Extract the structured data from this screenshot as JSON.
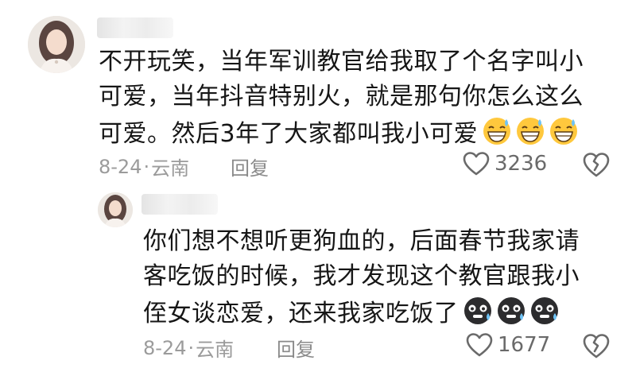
{
  "comments": [
    {
      "text": "不开玩笑，当年军训教官给我取了个名字叫小可爱，当年抖音特别火，就是那句你怎么这么可爱。然后3年了大家都叫我小可爱",
      "line1": "不开玩笑，当年军训教官给我取了个名字叫小",
      "line2": "可爱，当年抖音特别火，就是那句你怎么这么",
      "line3": "可爱。然后3年了大家都叫我小可爱",
      "emojis": [
        "grin-sweat-emoji",
        "grin-sweat-emoji",
        "grin-sweat-emoji"
      ],
      "date": "8-24",
      "location": "云南",
      "reply_label": "回复",
      "like_count": "3236"
    },
    {
      "text": "你们想不想听更狗血的，后面春节我家请客吃饭的时候，我才发现这个教官跟我小侄女谈恋爱，还来我家吃饭了",
      "line1": "你们想不想听更狗血的，后面春节我家请",
      "line2": "客吃饭的时候，我才发现这个教官跟我小",
      "line3": "侄女谈恋爱，还来我家吃饭了",
      "emojis": [
        "dark-sweat-emoji",
        "dark-sweat-emoji",
        "dark-sweat-emoji"
      ],
      "date": "8-24",
      "location": "云南",
      "reply_label": "回复",
      "like_count": "1677"
    }
  ],
  "separator": "·",
  "colors": {
    "text": "#161616",
    "meta": "#9b9b9b",
    "icon": "#6a6a6a",
    "emoji_yellow": "#ffc83d",
    "emoji_dark": "#2c2c2e"
  }
}
